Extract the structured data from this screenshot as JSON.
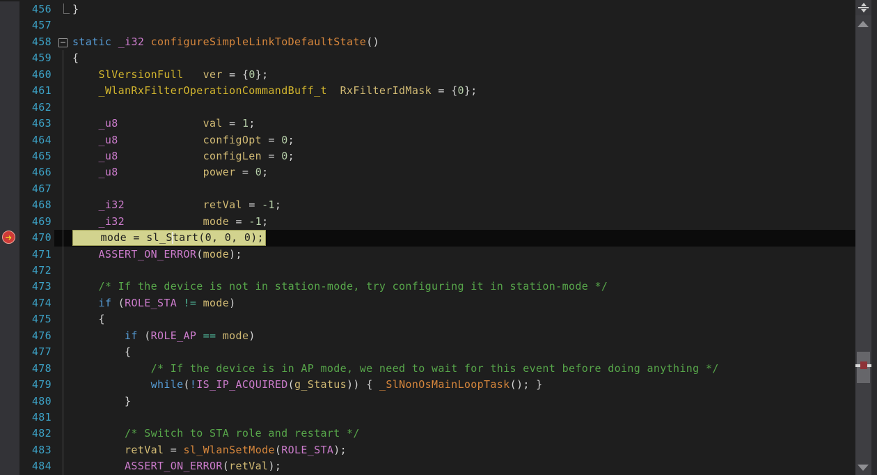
{
  "editor": {
    "first_line": 456,
    "last_line": 484,
    "breakpoint_line": 470,
    "current_line": 470,
    "background": "#1e1e1e",
    "current_line_background": "#0b0b0b",
    "statement_highlight_background": "#d2d38e",
    "line_number_color": "#3ca1c5",
    "gutter_background": "#333337",
    "token_colors": {
      "kw": "#569cd6",
      "type": "#d3b62e",
      "var": "#d1ba74",
      "num": "#b5cea8",
      "mac": "#cc7ccc",
      "fn": "#d6863c",
      "cmt": "#57a64a",
      "pl": "#d4d4d4",
      "cmp": "#4fb598",
      "hl": "#1d1d1d"
    },
    "lines": [
      {
        "n": 456,
        "tokens": [
          [
            "pl",
            "}"
          ]
        ]
      },
      {
        "n": 457,
        "tokens": []
      },
      {
        "n": 458,
        "tokens": [
          [
            "kw",
            "static"
          ],
          [
            "pl",
            " "
          ],
          [
            "mac",
            "_i32"
          ],
          [
            "pl",
            " "
          ],
          [
            "fn",
            "configureSimpleLinkToDefaultState"
          ],
          [
            "pl",
            "()"
          ]
        ]
      },
      {
        "n": 459,
        "tokens": [
          [
            "pl",
            "{"
          ]
        ]
      },
      {
        "n": 460,
        "tokens": [
          [
            "pl",
            "    "
          ],
          [
            "type",
            "SlVersionFull"
          ],
          [
            "pl",
            "   "
          ],
          [
            "var",
            "ver"
          ],
          [
            "pl",
            " = {"
          ],
          [
            "num",
            "0"
          ],
          [
            "pl",
            "};"
          ]
        ]
      },
      {
        "n": 461,
        "tokens": [
          [
            "pl",
            "    "
          ],
          [
            "type",
            "_WlanRxFilterOperationCommandBuff_t"
          ],
          [
            "pl",
            "  "
          ],
          [
            "var",
            "RxFilterIdMask"
          ],
          [
            "pl",
            " = {"
          ],
          [
            "num",
            "0"
          ],
          [
            "pl",
            "};"
          ]
        ]
      },
      {
        "n": 462,
        "tokens": []
      },
      {
        "n": 463,
        "tokens": [
          [
            "pl",
            "    "
          ],
          [
            "mac",
            "_u8"
          ],
          [
            "pl",
            "             "
          ],
          [
            "var",
            "val"
          ],
          [
            "pl",
            " = "
          ],
          [
            "num",
            "1"
          ],
          [
            "pl",
            ";"
          ]
        ]
      },
      {
        "n": 464,
        "tokens": [
          [
            "pl",
            "    "
          ],
          [
            "mac",
            "_u8"
          ],
          [
            "pl",
            "             "
          ],
          [
            "var",
            "configOpt"
          ],
          [
            "pl",
            " = "
          ],
          [
            "num",
            "0"
          ],
          [
            "pl",
            ";"
          ]
        ]
      },
      {
        "n": 465,
        "tokens": [
          [
            "pl",
            "    "
          ],
          [
            "mac",
            "_u8"
          ],
          [
            "pl",
            "             "
          ],
          [
            "var",
            "configLen"
          ],
          [
            "pl",
            " = "
          ],
          [
            "num",
            "0"
          ],
          [
            "pl",
            ";"
          ]
        ]
      },
      {
        "n": 466,
        "tokens": [
          [
            "pl",
            "    "
          ],
          [
            "mac",
            "_u8"
          ],
          [
            "pl",
            "             "
          ],
          [
            "var",
            "power"
          ],
          [
            "pl",
            " = "
          ],
          [
            "num",
            "0"
          ],
          [
            "pl",
            ";"
          ]
        ]
      },
      {
        "n": 467,
        "tokens": []
      },
      {
        "n": 468,
        "tokens": [
          [
            "pl",
            "    "
          ],
          [
            "mac",
            "_i32"
          ],
          [
            "pl",
            "            "
          ],
          [
            "var",
            "retVal"
          ],
          [
            "pl",
            " = "
          ],
          [
            "num",
            "-1"
          ],
          [
            "pl",
            ";"
          ]
        ]
      },
      {
        "n": 469,
        "tokens": [
          [
            "pl",
            "    "
          ],
          [
            "mac",
            "_i32"
          ],
          [
            "pl",
            "            "
          ],
          [
            "var",
            "mode"
          ],
          [
            "pl",
            " = "
          ],
          [
            "num",
            "-1"
          ],
          [
            "pl",
            ";"
          ]
        ]
      },
      {
        "n": 470,
        "highlight": true,
        "tokens": [
          [
            "hl",
            "    mode = sl_S"
          ],
          [
            "caret",
            ""
          ],
          [
            "hl",
            "tart(0, 0, 0);"
          ]
        ]
      },
      {
        "n": 471,
        "tokens": [
          [
            "pl",
            "    "
          ],
          [
            "mac",
            "ASSERT_ON_ERROR"
          ],
          [
            "pl",
            "("
          ],
          [
            "var",
            "mode"
          ],
          [
            "pl",
            ");"
          ]
        ]
      },
      {
        "n": 472,
        "tokens": []
      },
      {
        "n": 473,
        "tokens": [
          [
            "pl",
            "    "
          ],
          [
            "cmt",
            "/* If the device is not in station-mode, try configuring it in station-mode */"
          ]
        ]
      },
      {
        "n": 474,
        "tokens": [
          [
            "pl",
            "    "
          ],
          [
            "kw",
            "if"
          ],
          [
            "pl",
            " ("
          ],
          [
            "mac",
            "ROLE_STA"
          ],
          [
            "pl",
            " "
          ],
          [
            "cmp",
            "!="
          ],
          [
            "pl",
            " "
          ],
          [
            "var",
            "mode"
          ],
          [
            "pl",
            ")"
          ]
        ]
      },
      {
        "n": 475,
        "tokens": [
          [
            "pl",
            "    {"
          ]
        ]
      },
      {
        "n": 476,
        "tokens": [
          [
            "pl",
            "        "
          ],
          [
            "kw",
            "if"
          ],
          [
            "pl",
            " ("
          ],
          [
            "mac",
            "ROLE_AP"
          ],
          [
            "pl",
            " "
          ],
          [
            "cmp",
            "=="
          ],
          [
            "pl",
            " "
          ],
          [
            "var",
            "mode"
          ],
          [
            "pl",
            ")"
          ]
        ]
      },
      {
        "n": 477,
        "tokens": [
          [
            "pl",
            "        {"
          ]
        ]
      },
      {
        "n": 478,
        "tokens": [
          [
            "pl",
            "            "
          ],
          [
            "cmt",
            "/* If the device is in AP mode, we need to wait for this event before doing anything */"
          ]
        ]
      },
      {
        "n": 479,
        "tokens": [
          [
            "pl",
            "            "
          ],
          [
            "kw",
            "while"
          ],
          [
            "pl",
            "("
          ],
          [
            "kw",
            "!"
          ],
          [
            "mac",
            "IS_IP_ACQUIRED"
          ],
          [
            "pl",
            "("
          ],
          [
            "var",
            "g_Status"
          ],
          [
            "pl",
            ")) { "
          ],
          [
            "fn",
            "_SlNonOsMainLoopTask"
          ],
          [
            "pl",
            "(); }"
          ]
        ]
      },
      {
        "n": 480,
        "tokens": [
          [
            "pl",
            "        }"
          ]
        ]
      },
      {
        "n": 481,
        "tokens": []
      },
      {
        "n": 482,
        "tokens": [
          [
            "pl",
            "        "
          ],
          [
            "cmt",
            "/* Switch to STA role and restart */"
          ]
        ]
      },
      {
        "n": 483,
        "tokens": [
          [
            "pl",
            "        "
          ],
          [
            "var",
            "retVal"
          ],
          [
            "pl",
            " = "
          ],
          [
            "fn",
            "sl_WlanSetMode"
          ],
          [
            "pl",
            "("
          ],
          [
            "mac",
            "ROLE_STA"
          ],
          [
            "pl",
            ");"
          ]
        ]
      },
      {
        "n": 484,
        "tokens": [
          [
            "pl",
            "        "
          ],
          [
            "mac",
            "ASSERT_ON_ERROR"
          ],
          [
            "pl",
            "("
          ],
          [
            "var",
            "retVal"
          ],
          [
            "pl",
            ");"
          ]
        ]
      }
    ]
  },
  "icons": {
    "breakpoint_current": {
      "name": "breakpoint-current-arrow-icon",
      "glyph": "➜",
      "circle_color": "#cf3b38",
      "arrow_color": "#f5d02c"
    },
    "collapse": {
      "name": "collapse-toggle-icon",
      "glyph": "-"
    },
    "splitter": {
      "name": "split-editor-handle-icon"
    },
    "scroll_up": {
      "name": "scroll-up-arrow-icon"
    },
    "scroll_down": {
      "name": "scroll-down-arrow-icon"
    }
  },
  "scrollbar": {
    "track_color": "#3e3e42",
    "thumb_color": "#66666a",
    "breakpoint_marker_color": "#8e3338",
    "current_line_marker_color": "#d8d8d8"
  }
}
